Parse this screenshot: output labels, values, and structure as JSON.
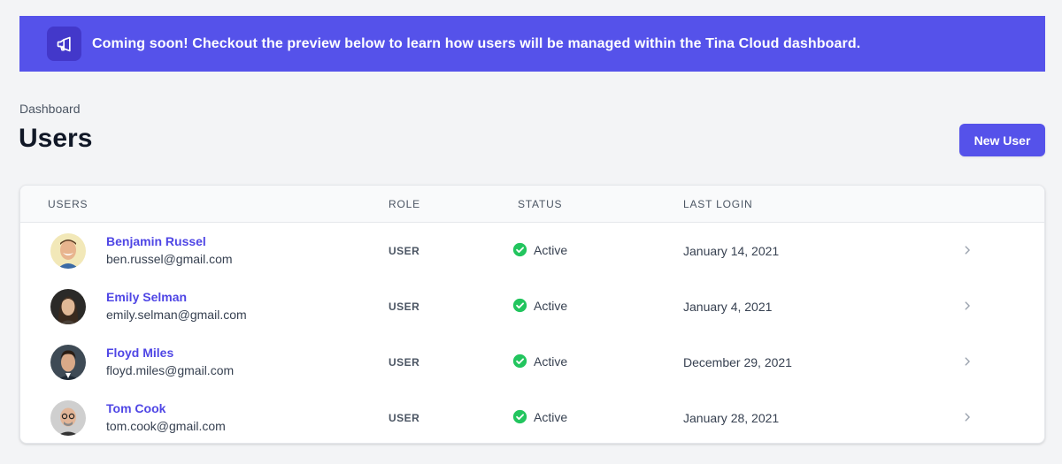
{
  "banner": {
    "text": "Coming soon! Checkout the preview below to learn how users will be managed within the Tina Cloud dashboard.",
    "icon": "megaphone-icon",
    "color": "#5552ea"
  },
  "header": {
    "breadcrumb": "Dashboard",
    "title": "Users",
    "new_user_label": "New User"
  },
  "table": {
    "columns": [
      "USERS",
      "ROLE",
      "STATUS",
      "LAST LOGIN"
    ],
    "rows": [
      {
        "name": "Benjamin Russel",
        "email": "ben.russel@gmail.com",
        "role": "USER",
        "status": "Active",
        "last_login": "January 14, 2021",
        "avatar_bg": "#f2e8b8"
      },
      {
        "name": "Emily Selman",
        "email": "emily.selman@gmail.com",
        "role": "USER",
        "status": "Active",
        "last_login": "January 4, 2021",
        "avatar_bg": "#2b2a28"
      },
      {
        "name": "Floyd Miles",
        "email": "floyd.miles@gmail.com",
        "role": "USER",
        "status": "Active",
        "last_login": "December 29, 2021",
        "avatar_bg": "#3e4a55"
      },
      {
        "name": "Tom Cook",
        "email": "tom.cook@gmail.com",
        "role": "USER",
        "status": "Active",
        "last_login": "January 28, 2021",
        "avatar_bg": "#cfcfcf"
      }
    ]
  },
  "colors": {
    "accent": "#5552ea",
    "link": "#4f46e5",
    "active": "#22c55e",
    "background": "#f3f4f6"
  }
}
